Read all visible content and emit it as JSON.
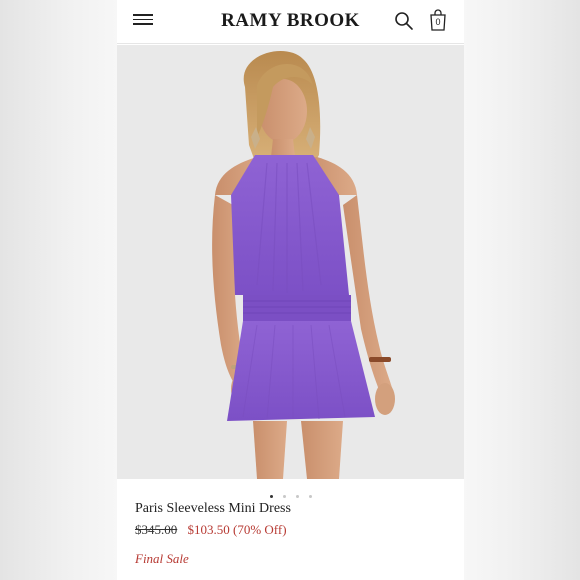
{
  "header": {
    "brand": "RAMY BROOK",
    "bag_count": "0",
    "icons": {
      "menu": "hamburger-menu-icon",
      "search": "search-icon",
      "bag": "shopping-bag-icon"
    }
  },
  "gallery": {
    "dot_count": 4,
    "active_index": 0
  },
  "product": {
    "name": "Paris Sleeveless Mini Dress",
    "original_price": "$345.00",
    "sale_price": "$103.50 (70% Off)",
    "badge": "Final Sale"
  },
  "colors": {
    "sale_red": "#b73a33",
    "dress_purple": "#8b5fd0",
    "background": "#e9e9e9"
  }
}
